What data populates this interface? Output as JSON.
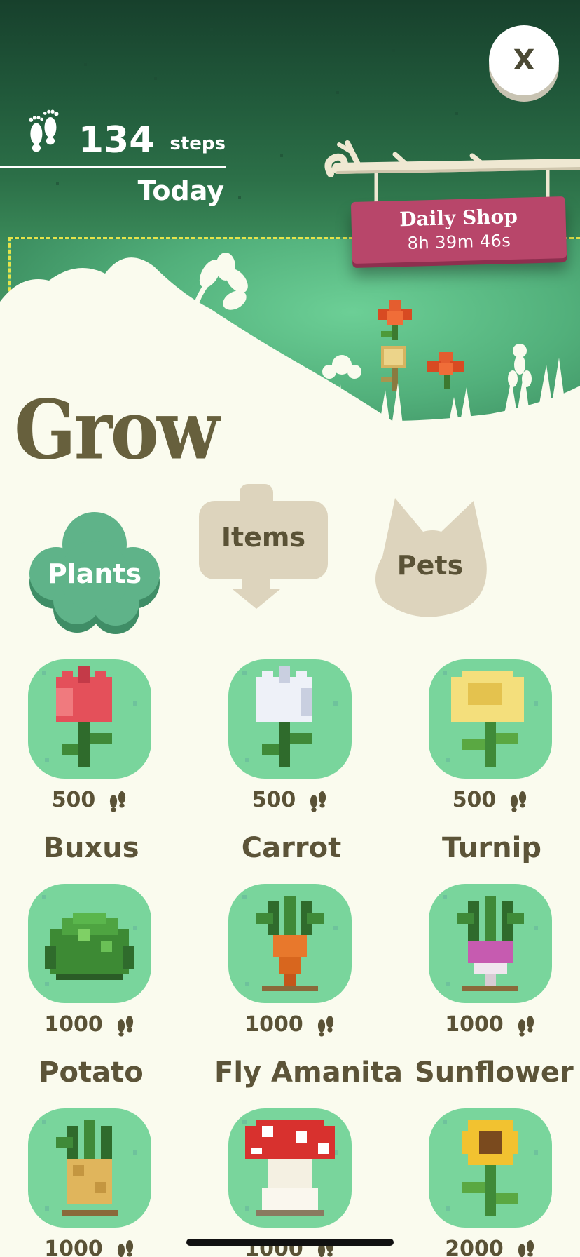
{
  "header": {
    "step_count": "134",
    "step_unit": "steps",
    "period": "Today",
    "close_label": "X"
  },
  "daily_shop": {
    "title": "Daily Shop",
    "timer": "8h 39m 46s"
  },
  "page_title": "Grow",
  "tabs": [
    {
      "label": "Plants",
      "active": true
    },
    {
      "label": "Items",
      "active": false
    },
    {
      "label": "Pets",
      "active": false
    }
  ],
  "plants": [
    {
      "name": "",
      "price": "500",
      "icon": "red-tulip-icon"
    },
    {
      "name": "",
      "price": "500",
      "icon": "white-tulip-icon"
    },
    {
      "name": "",
      "price": "500",
      "icon": "yellow-rose-icon"
    },
    {
      "name": "Buxus",
      "price": "1000",
      "icon": "buxus-bush-icon"
    },
    {
      "name": "Carrot",
      "price": "1000",
      "icon": "carrot-icon"
    },
    {
      "name": "Turnip",
      "price": "1000",
      "icon": "turnip-icon"
    },
    {
      "name": "Potato",
      "price": "1000",
      "icon": "potato-icon"
    },
    {
      "name": "Fly Amanita",
      "price": "1000",
      "icon": "fly-amanita-icon"
    },
    {
      "name": "Sunflower",
      "price": "2000",
      "icon": "sunflower-icon"
    }
  ],
  "colors": {
    "tile": "#79d59c",
    "active_tab": "#5fb389",
    "inactive_tab": "#ddd4bd",
    "sign": "#b8466a",
    "text": "#5c5438"
  }
}
